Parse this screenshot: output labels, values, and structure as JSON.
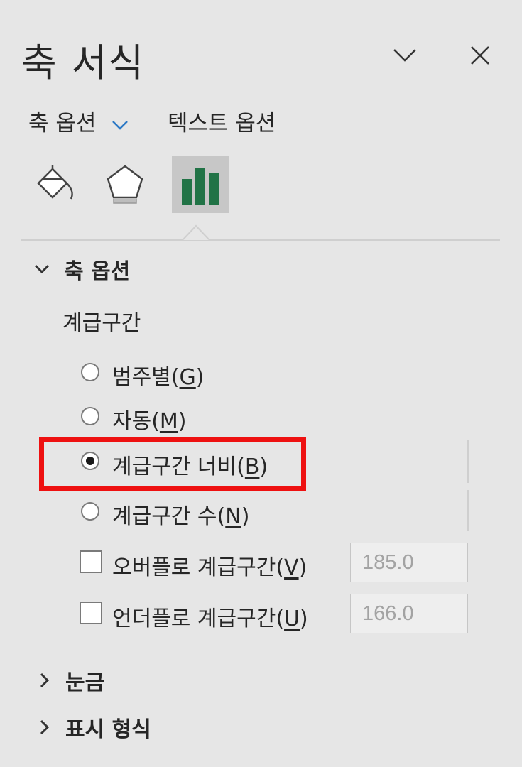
{
  "panel": {
    "title": "축 서식",
    "collapse_icon": "chevron-down-icon",
    "close_icon": "close-icon"
  },
  "tabs": [
    {
      "label": "축 옵션",
      "active": true
    },
    {
      "label": "텍스트 옵션",
      "active": false
    }
  ],
  "icon_tabs": [
    {
      "name": "fill-line-icon"
    },
    {
      "name": "effects-pentagon-icon"
    },
    {
      "name": "axis-options-chart-icon",
      "active": true
    }
  ],
  "axis_options": {
    "section_label": "축 옵션",
    "bins_label": "계급구간",
    "radios": [
      {
        "label": "범주별(",
        "key": "G",
        "tail": ")",
        "selected": false
      },
      {
        "label": "자동(",
        "key": "M",
        "tail": ")",
        "selected": false
      },
      {
        "label": "계급구간 너비(",
        "key": "B",
        "tail": ")",
        "selected": true
      },
      {
        "label": "계급구간 수(",
        "key": "N",
        "tail": ")",
        "selected": false
      }
    ],
    "checkboxes": [
      {
        "label": "오버플로 계급구간(",
        "key": "V",
        "tail": ")",
        "checked": false,
        "value": "185.0"
      },
      {
        "label": "언더플로 계급구간(",
        "key": "U",
        "tail": ")",
        "checked": false,
        "value": "166.0"
      }
    ]
  },
  "collapsed_sections": [
    {
      "label": "눈금"
    },
    {
      "label": "표시 형식"
    }
  ],
  "colors": {
    "accent": "#2b78c5",
    "chart_icon": "#217346",
    "highlight": "#ee1111"
  }
}
